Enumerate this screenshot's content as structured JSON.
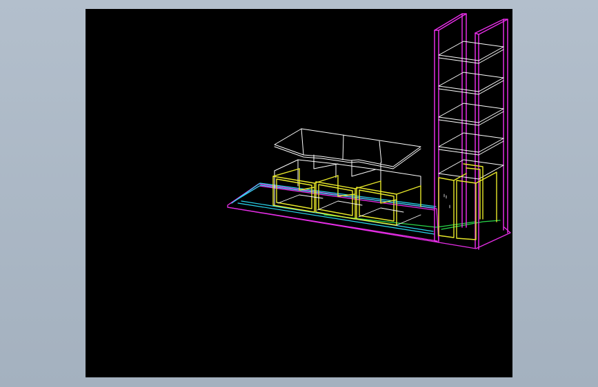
{
  "view": {
    "background_color": "#000000",
    "frame_color": "#a9b5c3"
  },
  "model": {
    "layer_colors": {
      "shelf_unit": "#e62ee6",
      "cabinet_box": "#e8e82a",
      "worktop_frame": "#ffffff",
      "plinth_edge": "#2ad8f0",
      "base_rail": "#29d94a"
    }
  }
}
